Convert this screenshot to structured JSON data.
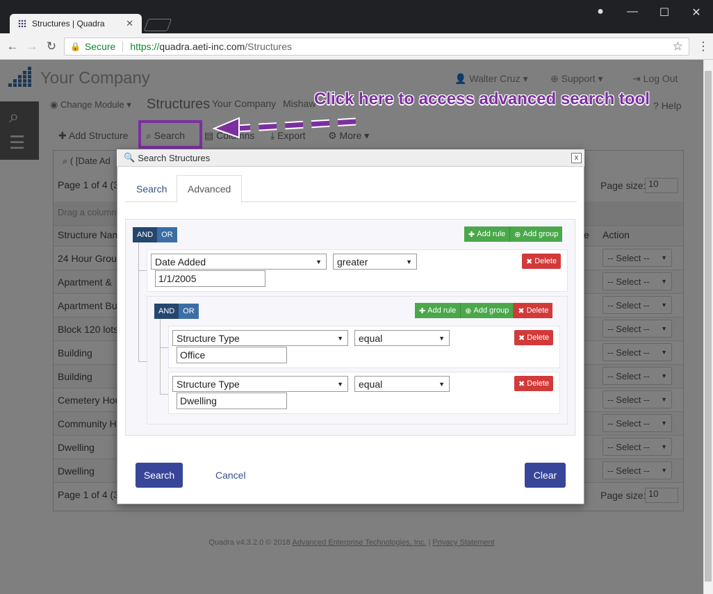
{
  "browser": {
    "tab_title": "Structures | Quadra",
    "secure_label": "Secure",
    "url_scheme": "https://",
    "url_host": "quadra.aeti-inc.com",
    "url_path": "/Structures"
  },
  "app": {
    "company": "Your Company",
    "user": "Walter Cruz",
    "support": "Support",
    "logout": "Log Out",
    "change_module": "Change Module",
    "section_title": "Structures",
    "breadcrumb_company": "Your Company",
    "breadcrumb_extra": "Mishaw",
    "help": "Help",
    "toolbar": {
      "add": "Add Structure",
      "search": "Search",
      "columns": "Columns",
      "export": "Export",
      "more": "More"
    },
    "filter_text": "( [Date Ad",
    "pager_text": "Page 1 of 4 (3",
    "page_size_label": "Page size:",
    "page_size_value": "10",
    "drag_hint": "Drag a column",
    "col_name": "Structure Nam",
    "col_e": "e",
    "col_action": "Action",
    "rows": [
      "24 Hour Group",
      "Apartment &",
      "Apartment Bu",
      "Block 120 lots",
      "Building",
      "Building",
      "Cemetery Hou",
      "Community Ho",
      "Dwelling",
      "Dwelling"
    ],
    "row_select": "-- Select --",
    "footer_text": "Quadra v4.3.2.0 © 2018 ",
    "footer_link1": "Advanced Enterprise Technologies, Inc.",
    "footer_sep": " | ",
    "footer_link2": "Privacy Statement"
  },
  "annotation": {
    "text": "Click here to access advanced search tool",
    "color": "#7b2fa0"
  },
  "modal": {
    "title": "Search Structures",
    "close": "x",
    "tabs": [
      "Search",
      "Advanced"
    ],
    "active_tab": "Advanced",
    "and": "AND",
    "or": "OR",
    "add_rule": "Add rule",
    "add_group": "Add group",
    "delete": "Delete",
    "rule1": {
      "field": "Date Added",
      "op": "greater",
      "value": "1/1/2005"
    },
    "rule2": {
      "field": "Structure Type",
      "op": "equal",
      "value": "Office"
    },
    "rule3": {
      "field": "Structure Type",
      "op": "equal",
      "value": "Dwelling"
    },
    "search_btn": "Search",
    "cancel_btn": "Cancel",
    "clear_btn": "Clear"
  }
}
